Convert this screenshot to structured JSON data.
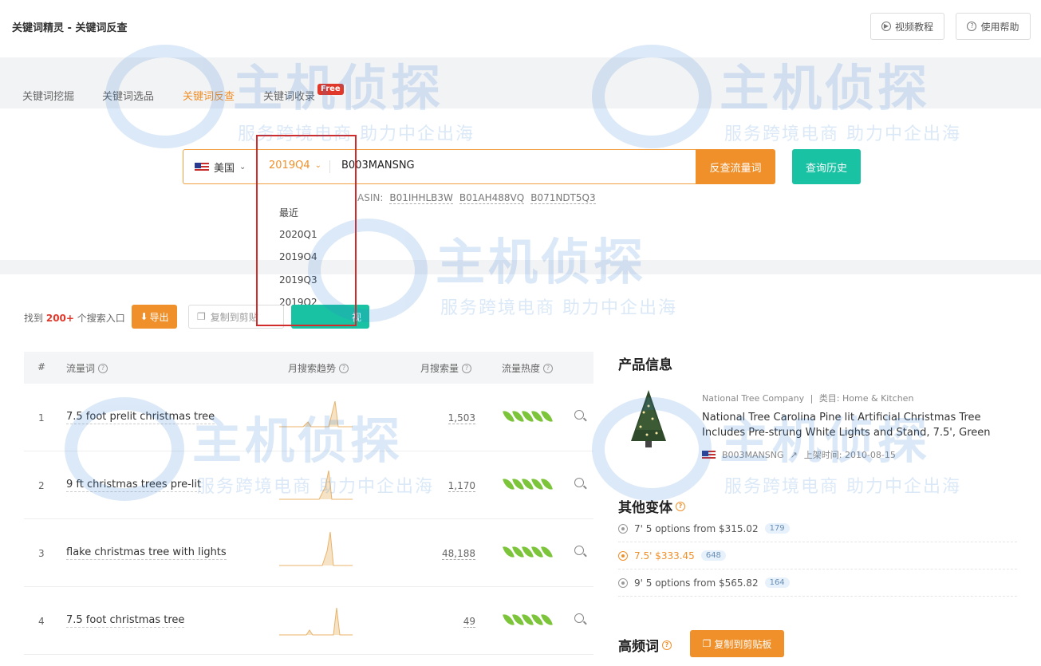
{
  "header": {
    "title": "关键词精灵 - 关键词反查",
    "video_btn": "视频教程",
    "help_btn": "使用帮助"
  },
  "tabs": [
    {
      "label": "关键词挖掘"
    },
    {
      "label": "关键词选品"
    },
    {
      "label": "关键词反查"
    },
    {
      "label": "关键词收录"
    }
  ],
  "free_badge": "Free",
  "search": {
    "country": "美国",
    "quarter": "2019Q4",
    "asin_value": "B003MANSNG",
    "submit": "反查流量词",
    "history": "查询历史",
    "hint_prefix": "ASIN:",
    "hint_asins": [
      "B01IHHLB3W",
      "B01AH488VQ",
      "B071NDT5Q3"
    ]
  },
  "quarter_dropdown": [
    "最近",
    "2020Q1",
    "2019Q4",
    "2019Q3",
    "2019Q2"
  ],
  "results": {
    "found_prefix": "找到",
    "found_count": "200+",
    "found_suffix": "个搜索入口",
    "export_label": "导出",
    "copy_label": "复制到剪贴",
    "teal_label": "视"
  },
  "table": {
    "headers": {
      "index": "#",
      "keyword": "流量词",
      "trend": "月搜索趋势",
      "volume": "月搜索量",
      "heat": "流量热度"
    },
    "rows": [
      {
        "index": "1",
        "keyword": "7.5 foot prelit christmas tree",
        "volume": "1,503",
        "heat": 5
      },
      {
        "index": "2",
        "keyword": "9 ft christmas trees pre-lit",
        "volume": "1,170",
        "heat": 5
      },
      {
        "index": "3",
        "keyword": "flake christmas tree with lights",
        "volume": "48,188",
        "heat": 5
      },
      {
        "index": "4",
        "keyword": "7.5 foot christmas tree",
        "volume": "49",
        "heat": 5
      }
    ]
  },
  "product": {
    "section_title": "产品信息",
    "brand": "National Tree Company",
    "category": "类目: Home & Kitchen",
    "name": "National Tree Carolina Pine lit Artificial Christmas Tree Includes Pre-strung White Lights and Stand, 7.5', Green",
    "asin": "B003MANSNG",
    "listed": "上架时间: 2010-08-15"
  },
  "variants": {
    "section_title": "其他变体",
    "items": [
      {
        "label": "7' 5 options from $315.02",
        "count": "179",
        "active": false
      },
      {
        "label": "7.5' $333.45",
        "count": "648",
        "active": true
      },
      {
        "label": "9' 5 options from $565.82",
        "count": "164",
        "active": false
      }
    ]
  },
  "high_freq": {
    "section_title": "高频词",
    "copy_label": "复制到剪贴板"
  },
  "watermark": {
    "main": "主机侦探",
    "sub": "服务跨境电商 助力中企出海"
  },
  "colors": {
    "accent": "#f0902a",
    "teal": "#19c2a3",
    "highlight": "#d22b2b"
  }
}
